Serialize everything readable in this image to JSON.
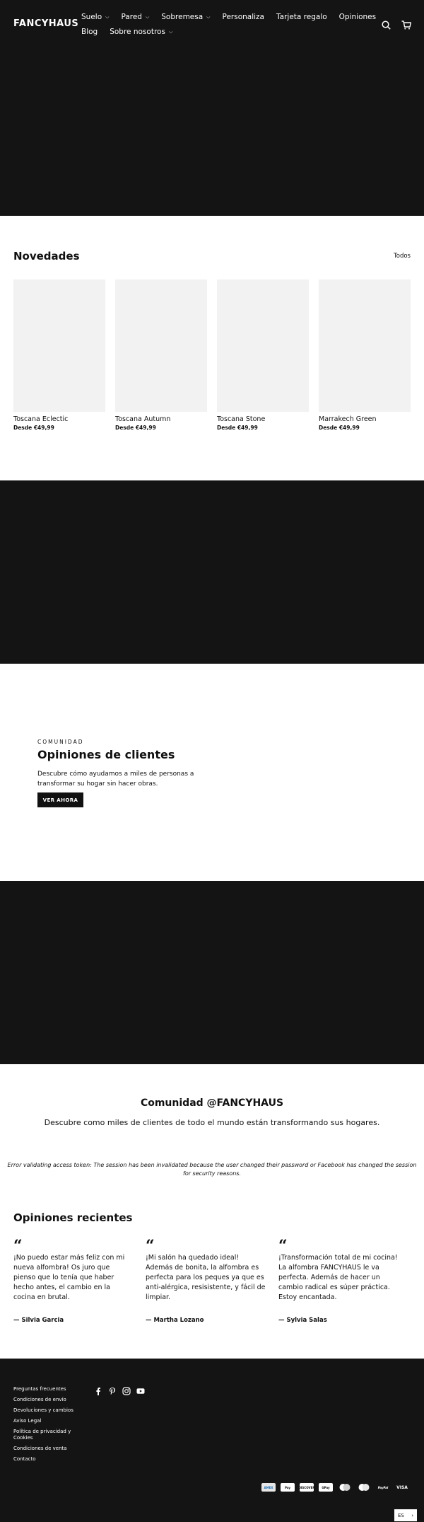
{
  "header": {
    "logo": "FANCYHAUS",
    "nav_row1": [
      {
        "label": "Suelo",
        "dropdown": true
      },
      {
        "label": "Pared",
        "dropdown": true
      },
      {
        "label": "Sobremesa",
        "dropdown": true
      },
      {
        "label": "Personaliza",
        "dropdown": false
      },
      {
        "label": "Tarjeta regalo",
        "dropdown": false
      },
      {
        "label": "Opiniones",
        "dropdown": false
      }
    ],
    "nav_row2": [
      {
        "label": "Blog",
        "dropdown": false
      },
      {
        "label": "Sobre nosotros",
        "dropdown": true
      }
    ],
    "icons": [
      "search-icon",
      "cart-icon"
    ]
  },
  "novedades": {
    "title": "Novedades",
    "view_all": "Todos",
    "products": [
      {
        "name": "Toscana Eclectic",
        "price": "Desde €49,99"
      },
      {
        "name": "Toscana Autumn",
        "price": "Desde €49,99"
      },
      {
        "name": "Toscana Stone",
        "price": "Desde €49,99"
      },
      {
        "name": "Marrakech Green",
        "price": "Desde €49,99"
      }
    ]
  },
  "comunidad": {
    "kicker": "COMUNIDAD",
    "title": "Opiniones de clientes",
    "description": "Descubre cómo ayudamos a miles de personas a transformar su hogar sin hacer obras.",
    "button": "VER AHORA"
  },
  "instagram": {
    "title": "Comunidad @FANCYHAUS",
    "subtitle": "Descubre como miles de clientes de todo el mundo están transformando sus hogares.",
    "error": "Error validating access token: The session has been invalidated because the user changed their password or Facebook has changed the session for security reasons."
  },
  "reviews": {
    "title": "Opiniones recientes",
    "quote_mark": "“",
    "items": [
      {
        "text": "¡No puedo estar más feliz con mi nueva alfombra! Os juro que pienso que lo tenía que haber hecho antes, el cambio en la cocina en brutal.",
        "author": "— Silvia Garcia"
      },
      {
        "text": "¡Mi salón ha quedado ideal! Además de bonita, la alfombra es perfecta para los peques ya que es anti-alérgica, resisistente, y fácil de limpiar.",
        "author": "— Martha Lozano"
      },
      {
        "text": "¡Transformación total de mi cocina! La alfombra FANCYHAUS le va perfecta. Además de hacer un cambio radical es súper práctica. Estoy encantada.",
        "author": "— Sylvia Salas"
      }
    ]
  },
  "footer": {
    "links": [
      "Preguntas frecuentes",
      "Condiciones de envío",
      "Devoluciones y cambios",
      "Aviso Legal",
      "Política de privacidad y Cookies",
      "Condiciones de venta",
      "Contacto"
    ],
    "social_icons": [
      "facebook-icon",
      "pinterest-icon",
      "instagram-icon",
      "youtube-icon"
    ],
    "payment_icons": [
      "amex-icon",
      "apple-pay-icon",
      "discover-icon",
      "google-pay-icon",
      "maestro-icon",
      "mastercard-icon",
      "paypal-icon",
      "visa-icon"
    ],
    "payment_labels": [
      "AMEX",
      "Pay",
      "DISCOVER",
      "GPay",
      "",
      "",
      "PayPal",
      "VISA"
    ],
    "language": "ES"
  },
  "colors": {
    "dark": "#141414",
    "placeholder": "#f2f2f2",
    "text": "#111111"
  }
}
